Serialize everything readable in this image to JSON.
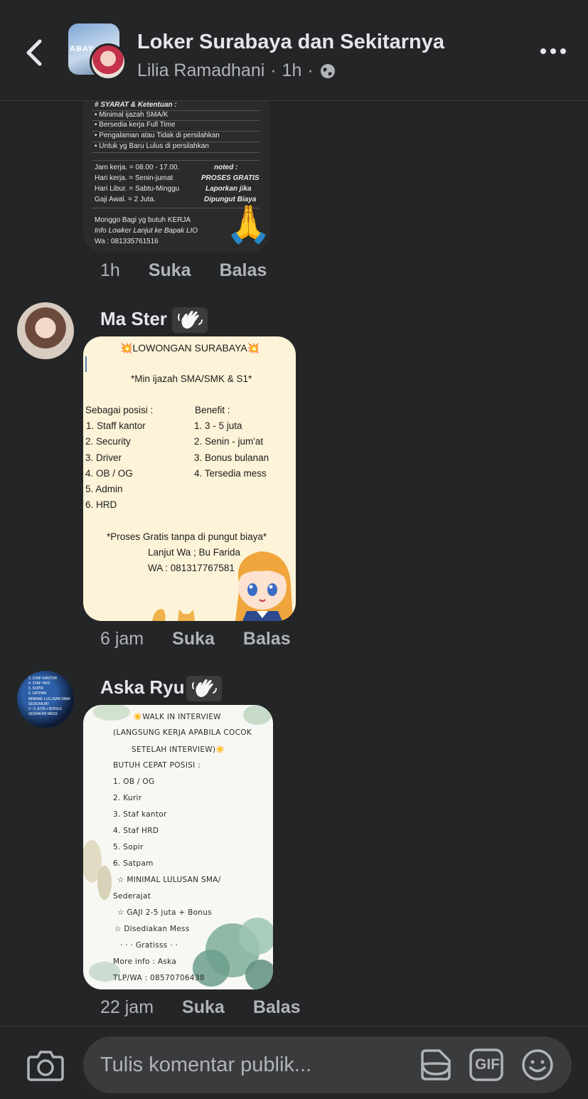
{
  "header": {
    "group_name": "Loker Surabaya dan Sekitarnya",
    "author": "Lilia Ramadhani",
    "time": "1h",
    "group_avatar_text": "ABAY"
  },
  "comments": [
    {
      "author": "",
      "time": "1h",
      "like": "Suka",
      "reply": "Balas",
      "image_lines": [
        "# SYARAT & Ketentuan :",
        "• Minimal ijazah SMA/K",
        "• Bersedia kerja Full Time",
        "• Pengalaman atau Tidak di persilahkan",
        "• Untuk yg Baru Lulus di persilahkan",
        "Jam kerja.  = 08.00 - 17.00.",
        "Hari kerja.   = Senin-jumat",
        "Hari Libur.   = Sabtu-Minggu",
        "Gaji Awal.   = 2 Juta.",
        "Monggo Bagi yg butuh KERJA",
        "Info Lowker Lanjut ke Bapak LIO",
        "Wa : 081335761516"
      ],
      "noted_lines": [
        "noted :",
        "PROSES GRATIS",
        "Laporkan jika",
        "Dipungut Biaya"
      ],
      "emoji": "🙏"
    },
    {
      "author": "Ma Ster",
      "time": "6 jam",
      "like": "Suka",
      "reply": "Balas",
      "image": {
        "title": "💥LOWONGAN SURABAYA💥",
        "subtitle": "*Min ijazah SMA/SMK & S1*",
        "left_header": "Sebagai posisi :",
        "left_items": [
          "1. Staff kantor",
          "2. Security",
          "3. Driver",
          "4. OB / OG",
          "5. Admin",
          "6. HRD"
        ],
        "right_header": "Benefit :",
        "right_items": [
          "1. 3 - 5 juta",
          "2. Senin - jum'at",
          "3. Bonus bulanan",
          "4. Tersedia mess"
        ],
        "footer1": "*Proses Gratis tanpa di pungut biaya*",
        "footer2": "Lanjut Wa ; Bu Farida",
        "footer3": "WA : 081317767581"
      }
    },
    {
      "author": "Aska Ryu",
      "time": "22 jam",
      "like": "Suka",
      "reply": "Balas",
      "avatar_lines": [
        "3. STAF KANTOR",
        "4. STAF HRD",
        "5. SOPIR",
        "6. SATPAM",
        "MINIMAL LULUSAN SMA/",
        "SEDERAJAT",
        "2 - 5 JUTA + BONUS",
        "SEDIAKAN MESS"
      ],
      "image_lines": [
        "☀️WALK IN INTERVIEW",
        "(LANGSUNG KERJA APABILA COCOK",
        "SETELAH INTERVIEW)☀️",
        "BUTUH CEPAT POSISI :",
        "1. OB / OG",
        "2. Kurir",
        "3. Staf kantor",
        "4. Staf HRD",
        "5. Sopir",
        "6. Satpam",
        "☆ MINIMAL LULUSAN SMA/",
        "Sederajat",
        "☆ GAJI 2-5 juta + Bonus",
        "☆ Disediakan Mess",
        "·  ·  ·  Gratisss  ·  ·",
        "More info : Aska",
        "TLP/WA      : 08570706438"
      ]
    }
  ],
  "composer": {
    "placeholder": "Tulis komentar publik...",
    "gif_label": "GIF"
  }
}
